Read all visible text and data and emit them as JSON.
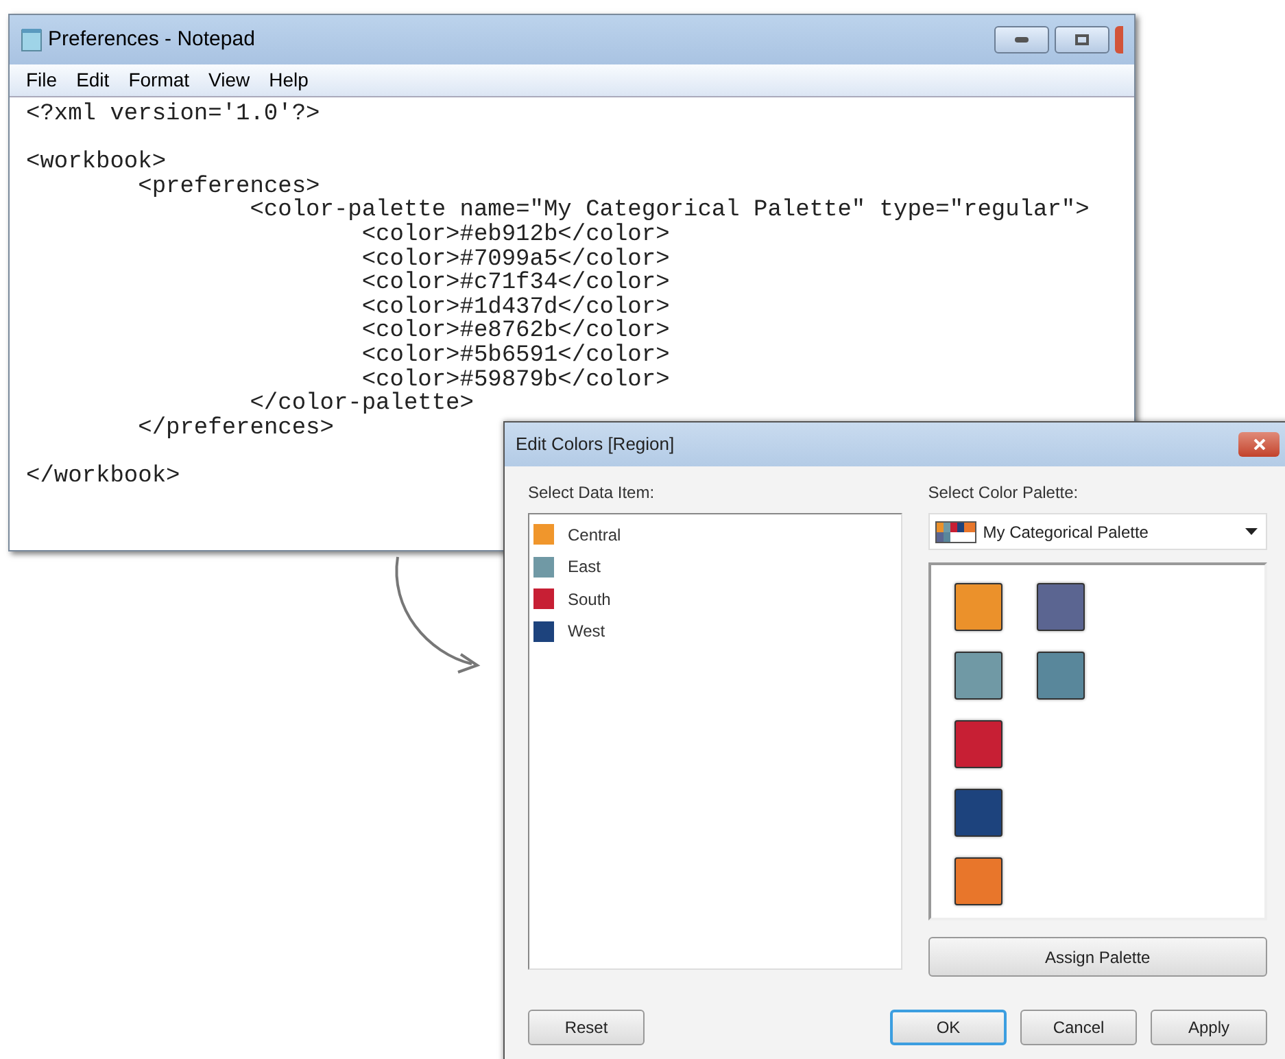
{
  "notepad": {
    "title": "Preferences - Notepad",
    "menu": [
      "File",
      "Edit",
      "Format",
      "View",
      "Help"
    ],
    "blocks": [
      [
        "<?xml version='1.0'?>"
      ],
      [
        "<workbook>",
        "\t<preferences>",
        "\t\t<color-palette name=\"My Categorical Palette\" type=\"regular\">",
        "\t\t\t<color>#eb912b</color>",
        "\t\t\t<color>#7099a5</color>",
        "\t\t\t<color>#c71f34</color>",
        "\t\t\t<color>#1d437d</color>",
        "\t\t\t<color>#e8762b</color>",
        "\t\t\t<color>#5b6591</color>",
        "\t\t\t<color>#59879b</color>",
        "\t\t</color-palette>",
        "\t</preferences>"
      ],
      [
        "</workbook>"
      ]
    ]
  },
  "dialog": {
    "title": "Edit Colors [Region]",
    "data_item_label": "Select Data Item:",
    "data_items": [
      {
        "label": "Central",
        "color": "#f0962c"
      },
      {
        "label": "East",
        "color": "#7099a5"
      },
      {
        "label": "South",
        "color": "#c71f34"
      },
      {
        "label": "West",
        "color": "#1d437d"
      }
    ],
    "palette_label": "Select Color Palette:",
    "palette_dropdown": {
      "value": "My Categorical Palette"
    },
    "swatches": [
      {
        "color": "#eb912b"
      },
      {
        "color": "#7099a5"
      },
      {
        "color": "#c71f34"
      },
      {
        "color": "#1d437d"
      },
      {
        "color": "#e8762b"
      },
      {
        "color": "#5b6591"
      },
      {
        "color": "#59879b"
      }
    ],
    "assign_button": "Assign Palette",
    "buttons": [
      {
        "label": "Reset",
        "kind": "left",
        "focused": false
      },
      {
        "label": "OK",
        "kind": "right",
        "focused": true
      },
      {
        "label": "Cancel",
        "kind": "right",
        "focused": false
      },
      {
        "label": "Apply",
        "kind": "right",
        "focused": false
      }
    ]
  }
}
